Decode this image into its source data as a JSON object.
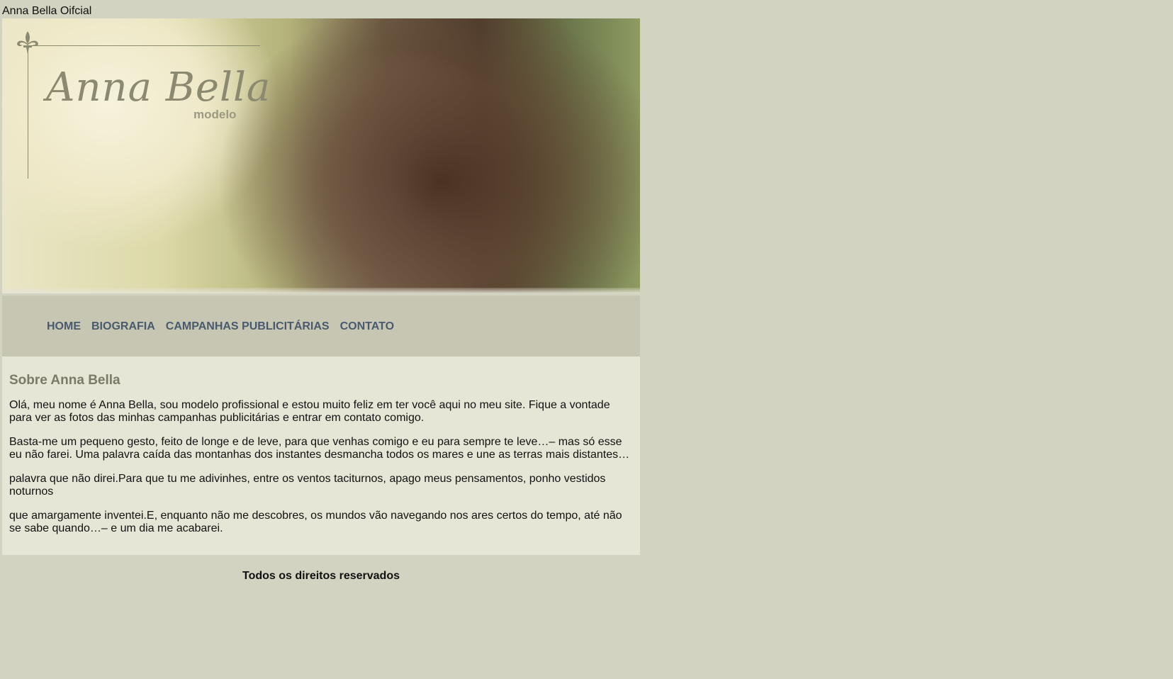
{
  "document": {
    "title": "Anna Bella Oifcial"
  },
  "banner": {
    "logo_script": "Anna Bella",
    "logo_sub": "modelo",
    "background_color": "#d3d3c1"
  },
  "nav": {
    "items": [
      {
        "label": "HOME"
      },
      {
        "label": "BIOGRAFIA"
      },
      {
        "label": "CAMPANHAS PUBLICITÁRIAS"
      },
      {
        "label": "CONTATO"
      }
    ],
    "link_color": "#4a5a6e",
    "bar_color": "#c6c6b2"
  },
  "main": {
    "heading": "Sobre Anna Bella",
    "paragraphs": [
      "Olá, meu nome é Anna Bella, sou modelo profissional e estou muito feliz em ter você aqui no meu site. Fique a vontade para ver as fotos das minhas campanhas publicitárias e entrar em contato comigo.",
      "Basta-me um pequeno gesto, feito de longe e de leve, para que venhas comigo e eu para sempre te leve…– mas só esse eu não farei. Uma palavra caída das montanhas dos instantes desmancha todos os mares e une as terras mais distantes…",
      "palavra que não direi.Para que tu me adivinhes, entre os ventos taciturnos, apago meus pensamentos, ponho vestidos noturnos",
      "que amargamente inventei.E, enquanto não me descobres, os mundos vão navegando nos ares certos do tempo, até não se sabe quando…– e um dia me acabarei."
    ],
    "heading_color": "#7a7a66",
    "background_color": "#e6e6d6"
  },
  "footer": {
    "text": "Todos os direitos reservados"
  }
}
